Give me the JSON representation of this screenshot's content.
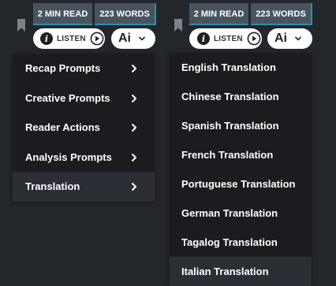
{
  "header": {
    "read_time": "2 MIN READ",
    "word_count": "223 WORDS",
    "listen_label": "LISTEN",
    "ai_label": "Ai"
  },
  "ai_menu": {
    "items": [
      {
        "label": "Recap Prompts"
      },
      {
        "label": "Creative Prompts"
      },
      {
        "label": "Reader Actions"
      },
      {
        "label": "Analysis Prompts"
      },
      {
        "label": "Translation"
      }
    ],
    "active_item": "Translation"
  },
  "translation_menu": {
    "items": [
      {
        "label": "English Translation"
      },
      {
        "label": "Chinese Translation"
      },
      {
        "label": "Spanish Translation"
      },
      {
        "label": "French Translation"
      },
      {
        "label": "Portuguese Translation"
      },
      {
        "label": "German Translation"
      },
      {
        "label": "Tagalog Translation"
      },
      {
        "label": "Italian Translation"
      }
    ],
    "hovered_item": "Italian Translation"
  },
  "colors": {
    "background": "#23262b",
    "menu_background": "#1a1c20",
    "badge_background": "#475460",
    "badge_accent": "#2a90a8",
    "active_row": "#2b2e34",
    "pill_background": "#ffffff"
  },
  "icons": [
    "bookmark-icon",
    "info-icon",
    "play-circle-icon",
    "chevron-down-icon",
    "chevron-right-icon"
  ]
}
